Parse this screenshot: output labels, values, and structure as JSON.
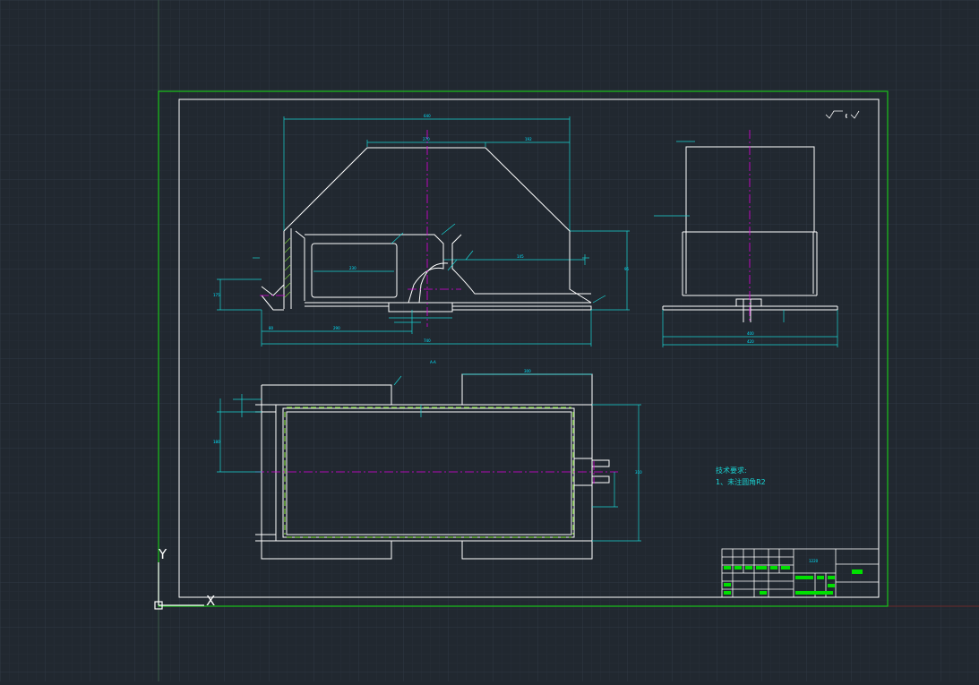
{
  "drawing": {
    "technical_requirements": {
      "heading": "技术要求:",
      "item_1": "1、未注圆角R2"
    },
    "title_block": {
      "part_code": "1220"
    },
    "dimension_labels": {
      "top_overall_width": "640",
      "top_inner_width": "270",
      "top_right_offset": "192",
      "front_left_height": "175",
      "front_hole_width": "230",
      "front_right_segment": "145",
      "front_right_height": "95",
      "front_bottom_1": "80",
      "front_bottom_2": "290",
      "front_bottom_3": "330",
      "front_bottom_overall": "740",
      "side_width_inner": "400",
      "side_width_outer": "420",
      "plan_top_slot": "300",
      "plan_left_height": "180",
      "plan_right_height": "310",
      "plan_center_mark": "A-A"
    },
    "ucs_axis": {
      "x_label": "X",
      "y_label": "Y"
    },
    "colors": {
      "background": "#212830",
      "grid": "#2d3640",
      "geometry": "#ffffff",
      "dimension": "#19d3d3",
      "centerline": "#e000e0",
      "hatch": "#7dd33a",
      "border_outer": "#19c319",
      "title_fill": "#00e000"
    }
  }
}
